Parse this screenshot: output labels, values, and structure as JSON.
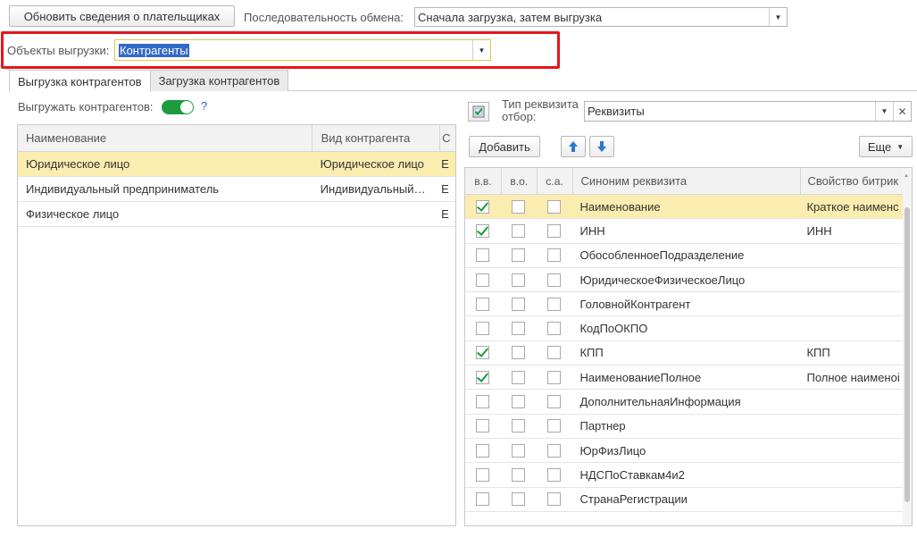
{
  "top": {
    "refresh_button": "Обновить сведения о плательщиках",
    "sequence_label": "Последовательность обмена:",
    "sequence_value": "Сначала загрузка, затем выгрузка",
    "objects_label": "Объекты выгрузки:",
    "objects_value": "Контрагенты"
  },
  "tabs": [
    {
      "label": "Выгрузка контрагентов",
      "active": true
    },
    {
      "label": "Загрузка контрагентов",
      "active": false
    }
  ],
  "left": {
    "toggle_label": "Выгружать контрагентов:",
    "toggle_on": true,
    "help": "?",
    "columns": [
      "Наименование",
      "Вид контрагента",
      "С"
    ],
    "rows": [
      {
        "name": "Юридическое лицо",
        "kind": "Юридическое лицо",
        "c": "Е",
        "selected": true
      },
      {
        "name": "Индивидуальный предприниматель",
        "kind": "Индивидуальный…",
        "c": "Е",
        "selected": false
      },
      {
        "name": "Физическое лицо",
        "kind": "",
        "c": "Е",
        "selected": false
      }
    ]
  },
  "right": {
    "type_label_line1": "Тип реквизита",
    "type_label_line2": "отбор:",
    "type_value": "Реквизиты",
    "add_button": "Добавить",
    "more_button": "Еще",
    "columns": [
      "в.в.",
      "в.о.",
      "с.а.",
      "Синоним реквизита",
      "Свойство битрик"
    ],
    "rows": [
      {
        "vv": true,
        "vo": false,
        "sa": false,
        "synonym": "Наименование",
        "property": "Краткое наименс",
        "selected": true
      },
      {
        "vv": true,
        "vo": false,
        "sa": false,
        "synonym": "ИНН",
        "property": "ИНН",
        "selected": false
      },
      {
        "vv": false,
        "vo": false,
        "sa": false,
        "synonym": "ОбособленноеПодразделение",
        "property": "",
        "selected": false
      },
      {
        "vv": false,
        "vo": false,
        "sa": false,
        "synonym": "ЮридическоеФизическоеЛицо",
        "property": "",
        "selected": false
      },
      {
        "vv": false,
        "vo": false,
        "sa": false,
        "synonym": "ГоловнойКонтрагент",
        "property": "",
        "selected": false
      },
      {
        "vv": false,
        "vo": false,
        "sa": false,
        "synonym": "КодПоОКПО",
        "property": "",
        "selected": false
      },
      {
        "vv": true,
        "vo": false,
        "sa": false,
        "synonym": "КПП",
        "property": "КПП",
        "selected": false
      },
      {
        "vv": true,
        "vo": false,
        "sa": false,
        "synonym": "НаименованиеПолное",
        "property": "Полное наименоі",
        "selected": false
      },
      {
        "vv": false,
        "vo": false,
        "sa": false,
        "synonym": "ДополнительнаяИнформация",
        "property": "",
        "selected": false
      },
      {
        "vv": false,
        "vo": false,
        "sa": false,
        "synonym": "Партнер",
        "property": "",
        "selected": false
      },
      {
        "vv": false,
        "vo": false,
        "sa": false,
        "synonym": "ЮрФизЛицо",
        "property": "",
        "selected": false
      },
      {
        "vv": false,
        "vo": false,
        "sa": false,
        "synonym": "НДСПоСтавкам4и2",
        "property": "",
        "selected": false
      },
      {
        "vv": false,
        "vo": false,
        "sa": false,
        "synonym": "СтранаРегистрации",
        "property": "",
        "selected": false
      }
    ]
  },
  "colors": {
    "highlight": "#e8141c",
    "selection": "#fbecb0",
    "accent": "#1e9b3c",
    "link": "#2a63c4",
    "arrow": "#2a78d6"
  }
}
